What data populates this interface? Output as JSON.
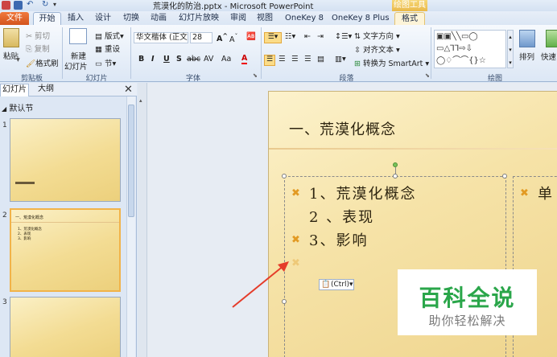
{
  "window": {
    "title": "荒漠化的防治.pptx - Microsoft PowerPoint",
    "context_header": "绘图工具"
  },
  "tabs": [
    "文件",
    "开始",
    "插入",
    "设计",
    "切换",
    "动画",
    "幻灯片放映",
    "审阅",
    "视图",
    "OneKey 8",
    "OneKey 8 Plus",
    "格式"
  ],
  "ribbon": {
    "clipboard": {
      "paste": "粘贴",
      "cut": "剪切",
      "copy": "复制",
      "format_painter": "格式刷",
      "label": "剪贴板"
    },
    "slides": {
      "new_slide": "新建",
      "new_slide2": "幻灯片",
      "layout": "版式",
      "reset": "重设",
      "section": "节",
      "label": "幻灯片"
    },
    "font": {
      "font_name": "华文楷体 (正文",
      "font_size": "28",
      "bold": "B",
      "italic": "I",
      "underline": "U",
      "shadow": "S",
      "strike": "abc",
      "spacing": "AV",
      "case": "Aa",
      "color": "A",
      "label": "字体"
    },
    "paragraph": {
      "text_direction": "文字方向",
      "align_text": "对齐文本",
      "convert_smartart": "转换为 SmartArt",
      "label": "段落"
    },
    "drawing": {
      "arrange": "排列",
      "quick_styles": "快速",
      "label": "绘图"
    }
  },
  "left_pane": {
    "tab_slides": "幻灯片",
    "tab_outline": "大纲",
    "close": "✕",
    "section_name": "默认节",
    "slide_numbers": [
      "1",
      "2",
      "3"
    ],
    "slide2_title": "一、荒漠化概念",
    "slide2_bullets": [
      "1、荒漠化概念",
      "2、表现",
      "3、影响"
    ]
  },
  "slide": {
    "title": "一、荒漠化概念",
    "bullets": [
      {
        "bullet": "✖",
        "text": "1、荒漠化概念"
      },
      {
        "bullet": "",
        "text": "2 、表现"
      },
      {
        "bullet": "✖",
        "text": "3、影响"
      }
    ],
    "right_box_text": "单",
    "paste_options": "(Ctrl)"
  },
  "watermark": {
    "main": "百科全说",
    "sub": "助你轻松解决"
  },
  "colors": {
    "file_tab": "#d3531d",
    "accent_bullet": "#e29a23",
    "watermark_green": "#2aa64a"
  }
}
